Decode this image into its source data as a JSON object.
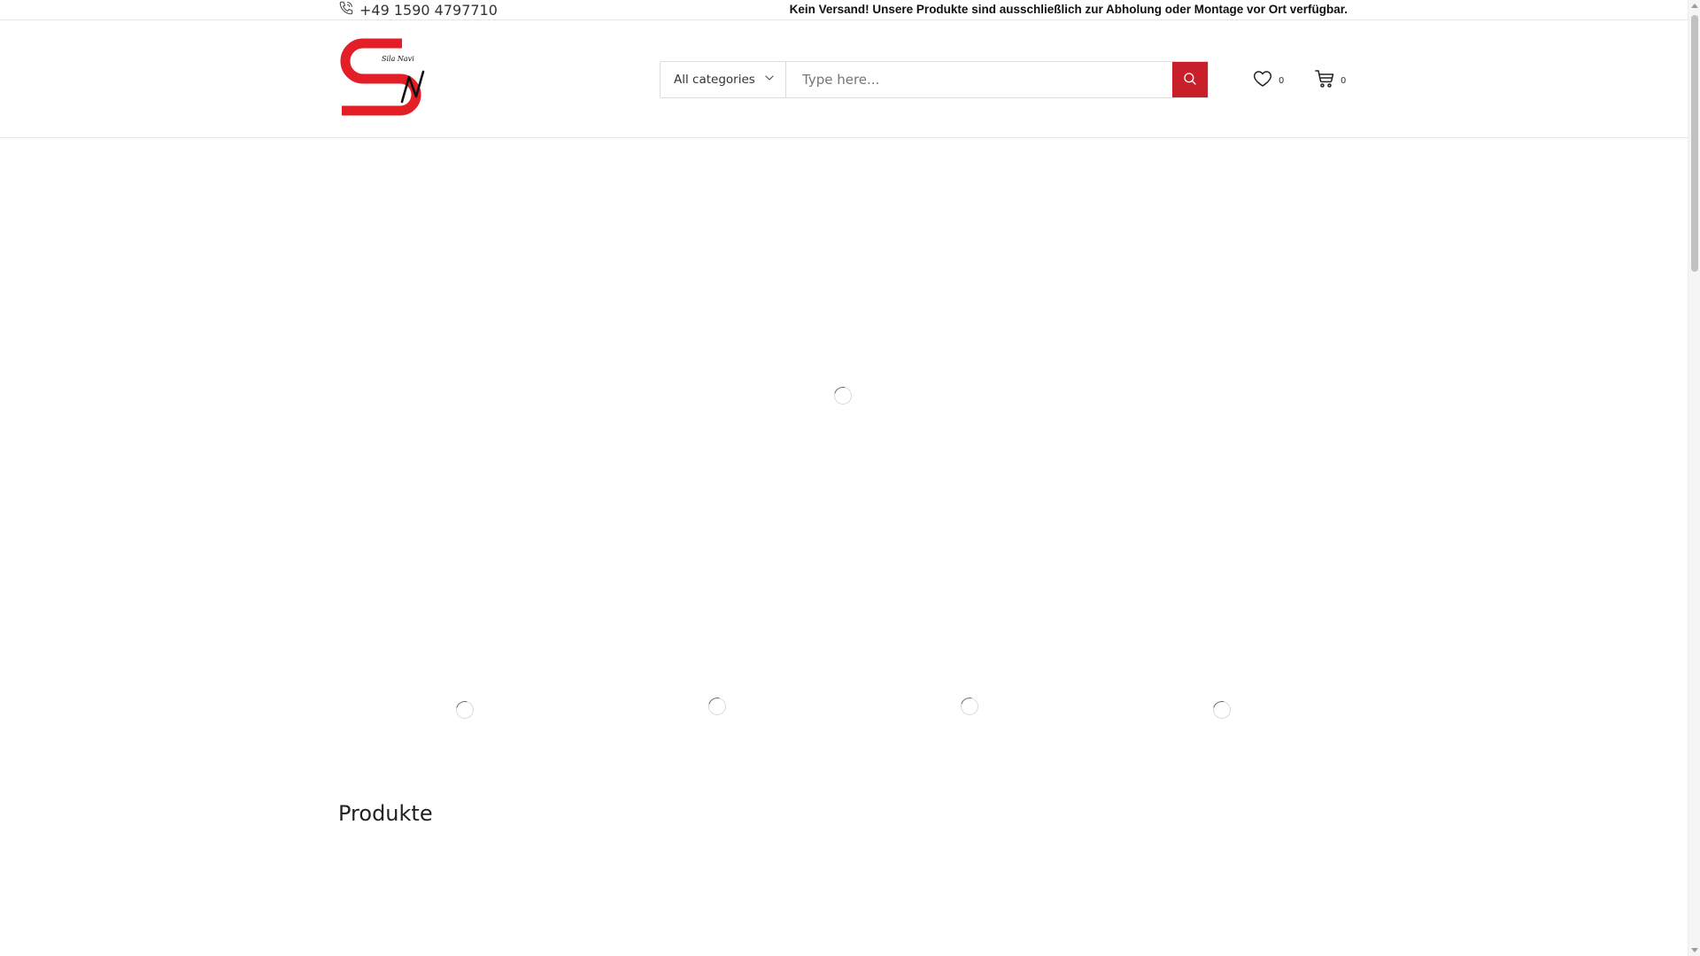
{
  "topbar": {
    "phone": "+49 1590 4797710",
    "phone_icon": "phone-icon",
    "notice": "Kein Versand! Unsere Produkte sind ausschließlich zur Abholung oder Montage vor Ort verfügbar."
  },
  "header": {
    "logo": {
      "text": "Sila Navi",
      "letters": "SN",
      "brand_color": "#e41e26"
    },
    "search": {
      "category_label": "All categories",
      "placeholder": "Type here...",
      "button_color": "#c8202a"
    },
    "wishlist": {
      "icon": "heart-icon",
      "count": "0"
    },
    "cart": {
      "icon": "cart-icon",
      "count": "0"
    }
  },
  "main": {
    "section_title": "Produkte"
  }
}
